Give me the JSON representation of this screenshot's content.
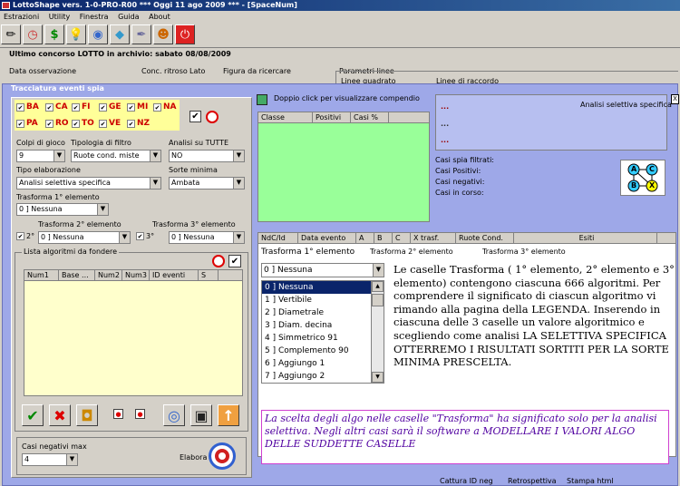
{
  "window": {
    "title": "LottoShape vers. 1-0-PRO-R00   ***   Oggi 11 ago 2009   ***   - [SpaceNum]"
  },
  "menu": [
    "Estrazioni",
    "Utility",
    "Finestra",
    "Guida",
    "About"
  ],
  "header": {
    "archive": "Ultimo concorso LOTTO in archivio: sabato 08/08/2009",
    "data_osservazione": "Data osservazione",
    "conc_ritroso": "Conc. ritroso",
    "lato": "Lato",
    "figura": "Figura da ricercare",
    "parametri": "Parametri linee",
    "linee_quadrato": "Linee quadrato",
    "linee_raccordo": "Linee di raccordo"
  },
  "spia": {
    "title": "Tracciatura eventi spia",
    "wheels_row1": [
      "BA",
      "CA",
      "FI",
      "GE",
      "MI",
      "NA"
    ],
    "wheels_row2": [
      "PA",
      "RO",
      "TO",
      "VE",
      "NZ"
    ],
    "colpi_label": "Colpi di gioco",
    "colpi_value": "9",
    "tipologia_label": "Tipologia di filtro",
    "tipologia_value": "Ruote cond. miste",
    "analisi_tutte_label": "Analisi su TUTTE",
    "analisi_tutte_value": "NO",
    "tipo_label": "Tipo elaborazione",
    "tipo_value": "Analisi selettiva specifica",
    "sorte_label": "Sorte minima",
    "sorte_value": "Ambata",
    "trasf1_label": "Trasforma 1° elemento",
    "trasf1_value": "0 ] Nessuna",
    "trasf2_label": "Trasforma 2° elemento",
    "trasf2_value": "0 ] Nessuna",
    "trasf3_label": "Trasforma 3° elemento",
    "trasf3_value": "0 ] Nessuna",
    "check2": "2°",
    "check3": "3°",
    "lista_label": "Lista algoritmi da fondere",
    "lista_cols": [
      "Num1",
      "Base ...",
      "Num2",
      "Num3",
      "ID eventi",
      "S"
    ],
    "casi_neg_label": "Casi negativi max",
    "casi_neg_value": "4",
    "elabora": "Elabora"
  },
  "right": {
    "compendio": "Doppio click per visualizzare compendio",
    "classe_cols": [
      "Classe",
      "Positivi",
      "Casi %"
    ],
    "analisi_selettiva": "Analisi selettiva specifica",
    "dots": [
      "...",
      "...",
      "..."
    ],
    "casi_filtrati": "Casi spia filtrati:",
    "casi_positivi": "Casi Positivi:",
    "casi_negativi": "Casi negativi:",
    "casi_corso": "Casi in corso:",
    "diagram_labels": [
      "A",
      "C",
      "B",
      "X"
    ],
    "event_cols": [
      "NdC/Id",
      "Data evento",
      "A",
      "B",
      "C",
      "X trasf.",
      "Ruote Cond.",
      "Esiti"
    ],
    "trasf1": "Trasforma 1° elemento",
    "trasf2": "Trasforma 2° elemento",
    "trasf3": "Trasforma 3° elemento",
    "dropdown_value": "0 ] Nessuna",
    "list_items": [
      "0 ] Nessuna",
      "1 ] Vertibile",
      "2 ] Diametrale",
      "3 ] Diam. decina",
      "4 ] Simmetrico 91",
      "5 ] Complemento 90",
      "6 ] Aggiungo 1",
      "7 ] Aggiungo 2"
    ],
    "legend": "Le caselle Trasforma ( 1° elemento, 2° elemento e 3° elemento) contengono ciascuna 666 algoritmi. Per comprendere il significato di ciascun algoritmo vi rimando alla pagina della LEGENDA. Inserendo in ciascuna delle 3 caselle un valore algoritmico e scegliendo come analisi LA SELETTIVA SPECIFICA OTTERREMO I RISULTATI SORTITI PER LA SORTE MINIMA PRESCELTA.",
    "note": "La scelta degli algo nelle caselle \"Trasforma\" ha significato solo per la analisi selettiva. Negli altri casi sarà il software a MODELLARE I VALORI ALGO DELLE SUDDETTE CASELLE",
    "bottom_buttons": [
      "Cattura ID neg",
      "Retrospettiva",
      "Stampa html"
    ]
  }
}
